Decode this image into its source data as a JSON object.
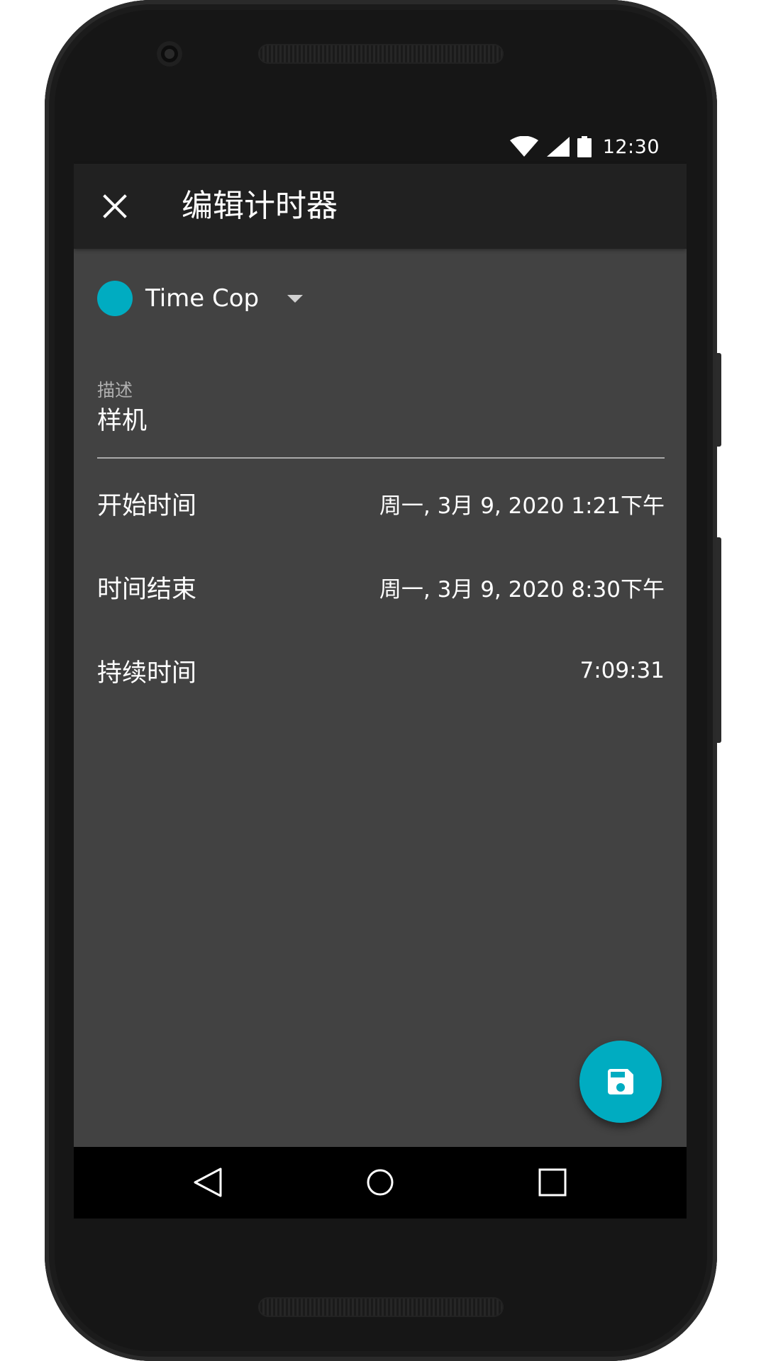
{
  "status_bar": {
    "time": "12:30",
    "icons": [
      "wifi-icon",
      "cell-signal-icon",
      "battery-icon"
    ]
  },
  "app_bar": {
    "close_icon": "close-icon",
    "title": "编辑计时器"
  },
  "project": {
    "name": "Time Cop",
    "color": "#00acc1",
    "dropdown_icon": "caret-down-icon"
  },
  "description": {
    "label": "描述",
    "value": "样机"
  },
  "start": {
    "label": "开始时间",
    "value": "周一, 3月 9, 2020 1:21下午"
  },
  "end": {
    "label": "时间结束",
    "value": "周一, 3月 9, 2020 8:30下午"
  },
  "duration": {
    "label": "持续时间",
    "value": "7:09:31"
  },
  "fab": {
    "icon": "save-icon",
    "color": "#00acc1"
  },
  "nav": {
    "back_icon": "back-icon",
    "home_icon": "home-icon",
    "recents_icon": "recents-icon"
  }
}
